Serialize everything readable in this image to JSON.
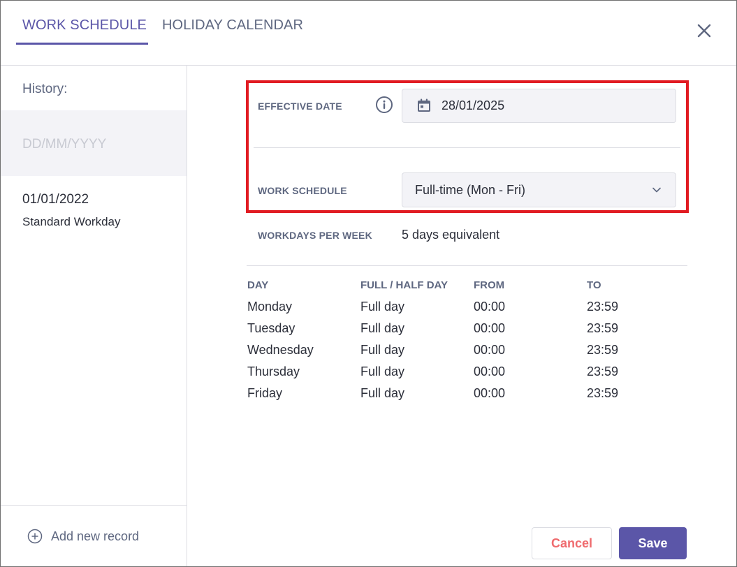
{
  "tabs": [
    {
      "label": "WORK SCHEDULE",
      "active": true
    },
    {
      "label": "HOLIDAY CALENDAR",
      "active": false
    }
  ],
  "sidebar": {
    "title": "History:",
    "new_entry_placeholder": "DD/MM/YYYY",
    "items": [
      {
        "date": "01/01/2022",
        "label": "Standard Workday"
      }
    ],
    "add_record_label": "Add new record"
  },
  "form": {
    "effective_date_label": "EFFECTIVE DATE",
    "effective_date_value": "28/01/2025",
    "work_schedule_label": "WORK SCHEDULE",
    "work_schedule_value": "Full-time (Mon - Fri)",
    "workdays_label": "WORKDAYS PER WEEK",
    "workdays_value": "5 days equivalent"
  },
  "schedule_table": {
    "headers": [
      "DAY",
      "FULL / HALF DAY",
      "FROM",
      "TO"
    ],
    "rows": [
      [
        "Monday",
        "Full day",
        "00:00",
        "23:59"
      ],
      [
        "Tuesday",
        "Full day",
        "00:00",
        "23:59"
      ],
      [
        "Wednesday",
        "Full day",
        "00:00",
        "23:59"
      ],
      [
        "Thursday",
        "Full day",
        "00:00",
        "23:59"
      ],
      [
        "Friday",
        "Full day",
        "00:00",
        "23:59"
      ]
    ]
  },
  "buttons": {
    "cancel_label": "Cancel",
    "save_label": "Save"
  },
  "colors": {
    "accent": "#5b56a8",
    "cancel_text": "#ef6b6e",
    "highlight_border": "#e11b22",
    "label_gray": "#5e6780"
  },
  "icons": {
    "close": "close-icon",
    "info": "info-icon",
    "calendar": "calendar-icon",
    "dropdown": "chevron-down-icon",
    "add": "plus-circle-icon"
  }
}
